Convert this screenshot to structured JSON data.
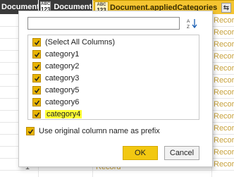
{
  "columns": [
    {
      "title": "Document...",
      "type_top": "",
      "type_bottom": ""
    },
    {
      "title": "Document...",
      "type_top": "ABC",
      "type_bottom": "123"
    },
    {
      "title": "Document.appliedCategories",
      "type_top": "ABC",
      "type_bottom": "123"
    }
  ],
  "cell_value": "Record",
  "row_number": "1",
  "dropdown": {
    "search_value": "",
    "sort_icon": "sort-ascending-icon",
    "items": [
      {
        "label": "(Select All Columns)",
        "checked": true,
        "highlighted": false
      },
      {
        "label": "category1",
        "checked": true,
        "highlighted": false
      },
      {
        "label": "category2",
        "checked": true,
        "highlighted": false
      },
      {
        "label": "category3",
        "checked": true,
        "highlighted": false
      },
      {
        "label": "category5",
        "checked": true,
        "highlighted": false
      },
      {
        "label": "category6",
        "checked": true,
        "highlighted": false
      },
      {
        "label": "category4",
        "checked": true,
        "highlighted": true
      }
    ],
    "use_prefix_label": "Use original column name as prefix",
    "use_prefix_checked": true,
    "ok_label": "OK",
    "cancel_label": "Cancel"
  },
  "colors": {
    "accent": "#f2c811",
    "highlight": "#ffff33",
    "header_dark": "#3a3a3a",
    "record_text": "#c8a23c"
  }
}
